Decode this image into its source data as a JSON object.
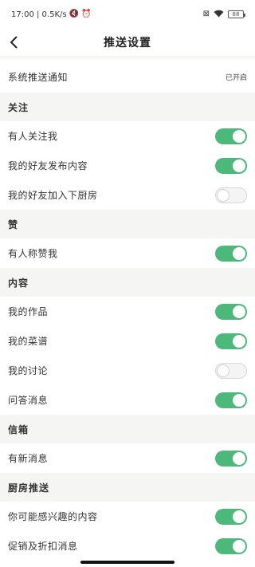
{
  "status_bar": {
    "time_net": "17:00 | 0.5K/s",
    "battery": "88"
  },
  "nav": {
    "title": "推送设置"
  },
  "system_push": {
    "label": "系统推送通知",
    "value": "已开启"
  },
  "sections": [
    {
      "title": "关注",
      "items": [
        {
          "label": "有人关注我",
          "on": true
        },
        {
          "label": "我的好友发布内容",
          "on": true
        },
        {
          "label": "我的好友加入下厨房",
          "on": false
        }
      ]
    },
    {
      "title": "赞",
      "items": [
        {
          "label": "有人称赞我",
          "on": true
        }
      ]
    },
    {
      "title": "内容",
      "items": [
        {
          "label": "我的作品",
          "on": true
        },
        {
          "label": "我的菜谱",
          "on": true
        },
        {
          "label": "我的讨论",
          "on": false
        },
        {
          "label": "问答消息",
          "on": true
        }
      ]
    },
    {
      "title": "信箱",
      "items": [
        {
          "label": "有新消息",
          "on": true
        }
      ]
    },
    {
      "title": "厨房推送",
      "items": [
        {
          "label": "你可能感兴趣的内容",
          "on": true
        },
        {
          "label": "促销及折扣消息",
          "on": true
        }
      ]
    }
  ],
  "colors": {
    "toggle_on": "#4cb87a",
    "section_bg": "#f5f5f3"
  }
}
